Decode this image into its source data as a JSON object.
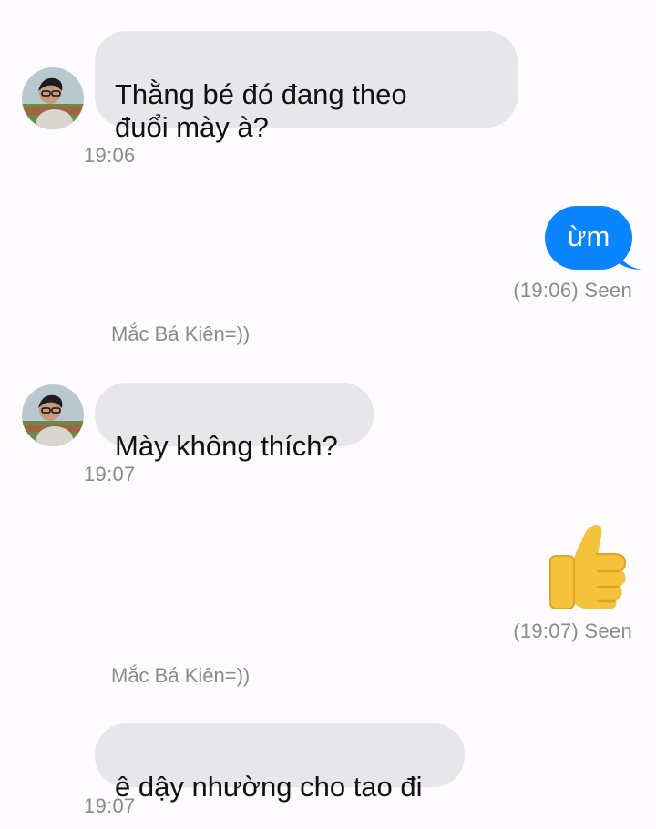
{
  "conversation": {
    "messages": [
      {
        "direction": "incoming",
        "text": "Thằng bé đó đang theo\nđuổi mày à?",
        "time": "19:06"
      },
      {
        "direction": "outgoing",
        "text": "ừm",
        "status": "(19:06) Seen"
      },
      {
        "type": "nickname_note",
        "text": "Mắc Bá Kiên=))"
      },
      {
        "direction": "incoming",
        "text": "Mày không thích?",
        "time": "19:07"
      },
      {
        "direction": "outgoing",
        "emoji": "thumbs-up",
        "status": "(19:07) Seen"
      },
      {
        "type": "nickname_note",
        "text": "Mắc Bá Kiên=))"
      },
      {
        "direction": "incoming",
        "text": "ê dậy nhường cho tao đi",
        "time": "19:07"
      }
    ]
  },
  "colors": {
    "background": "#fdfbfd",
    "incoming_bubble": "#e6e6eb",
    "outgoing_bubble": "#0a84ff",
    "meta_text": "#8b8b8f",
    "emoji_thumb": "#f5c33b"
  }
}
